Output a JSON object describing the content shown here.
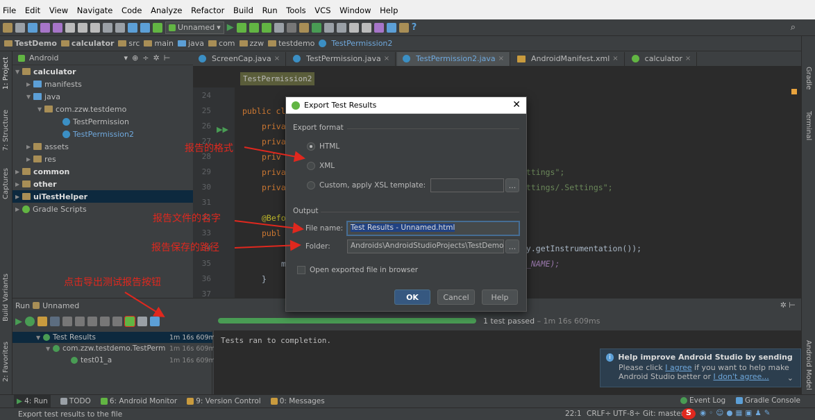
{
  "menu": [
    "File",
    "Edit",
    "View",
    "Navigate",
    "Code",
    "Analyze",
    "Refactor",
    "Build",
    "Run",
    "Tools",
    "VCS",
    "Window",
    "Help"
  ],
  "toolbar": {
    "run_config": "Unnamed"
  },
  "nav_breadcrumb": [
    "TestDemo",
    "calculator",
    "src",
    "main",
    "java",
    "com",
    "zzw",
    "testdemo",
    "TestPermission2"
  ],
  "project": {
    "view_mode": "Android",
    "items": [
      "calculator",
      "manifests",
      "java",
      "com.zzw.testdemo",
      "TestPermission",
      "TestPermission2",
      "assets",
      "res",
      "common",
      "other",
      "uiTestHelper",
      "Gradle Scripts"
    ]
  },
  "left_strip": {
    "project": "1: Project",
    "structure": "7: Structure",
    "captures": "Captures",
    "build_variants": "Build Variants",
    "favorites": "2: Favorites"
  },
  "right_strip": {
    "gradle": "Gradle",
    "terminal": "Terminal",
    "android_model": "Android Model"
  },
  "tabs": [
    {
      "label": "ScreenCap.java"
    },
    {
      "label": "TestPermission.java"
    },
    {
      "label": "TestPermission2.java"
    },
    {
      "label": "AndroidManifest.xml"
    },
    {
      "label": "calculator"
    }
  ],
  "editor": {
    "class_tag": "TestPermission2",
    "line_numbers": [
      "24",
      "25",
      "26",
      "27",
      "28",
      "29",
      "30",
      "31",
      "32",
      "33",
      "34",
      "35",
      "36",
      "37"
    ],
    "lines": {
      "l25": "public cl",
      "l26": "priva",
      "l27": "priva",
      "l28": "priv",
      "l29a": "priva",
      "l29b": "ettings\";",
      "l30a": "priva",
      "l30b": "ettings/.Settings\";",
      "l32": "@Befo",
      "l33": "publ",
      "l34": "ry.getInstrumentation());",
      "l35a": "m",
      "l35b": "E_NAME);",
      "l36": "}"
    }
  },
  "run": {
    "header": "Run",
    "config": "Unnamed",
    "status": "1 test passed",
    "duration": "1m 16s 609ms",
    "progress": 1.0,
    "tree": [
      {
        "label": "Test Results",
        "time": "1m 16s 609ms"
      },
      {
        "label": "com.zzw.testdemo.TestPerm",
        "time": "1m 16s 609ms"
      },
      {
        "label": "test01_a",
        "time": "1m 16s 609ms"
      }
    ],
    "console": "Tests ran to completion."
  },
  "dialog": {
    "title": "Export Test Results",
    "export_format_label": "Export format",
    "html_label": "HTML",
    "xml_label": "XML",
    "custom_label": "Custom, apply XSL template:",
    "output_label": "Output",
    "file_name_label": "File name:",
    "file_name_value": "Test Results - Unnamed.html",
    "folder_label": "Folder:",
    "folder_value": "Androids\\AndroidStudioProjects\\TestDemo",
    "open_label": "Open exported file in browser",
    "browse": "...",
    "ok": "OK",
    "cancel": "Cancel",
    "help": "Help"
  },
  "annotations": {
    "format": "报告的格式",
    "filename": "报告文件的名字",
    "path": "报告保存的路径",
    "export_btn": "点击导出测试报告按钮"
  },
  "notification": {
    "title": "Help improve Android Studio by sending us",
    "line1_pre": "Please click ",
    "agree": "I agree",
    "line1_post": " if you want to help make",
    "line2_pre": "Android Studio better or ",
    "disagree": "I don't agree..."
  },
  "bottom_tabs": [
    "4: Run",
    "TODO",
    "6: Android Monitor",
    "9: Version Control",
    "0: Messages"
  ],
  "bottom_right": [
    "Event Log",
    "Gradle Console"
  ],
  "status": {
    "message": "Export test results to the file",
    "position": "22:1",
    "line_sep": "CRLF÷",
    "encoding": "UTF-8÷",
    "vcs": "Git: master"
  },
  "colors": {
    "accent": "#365880",
    "pass": "#499c54",
    "annotation": "#e0281e"
  }
}
